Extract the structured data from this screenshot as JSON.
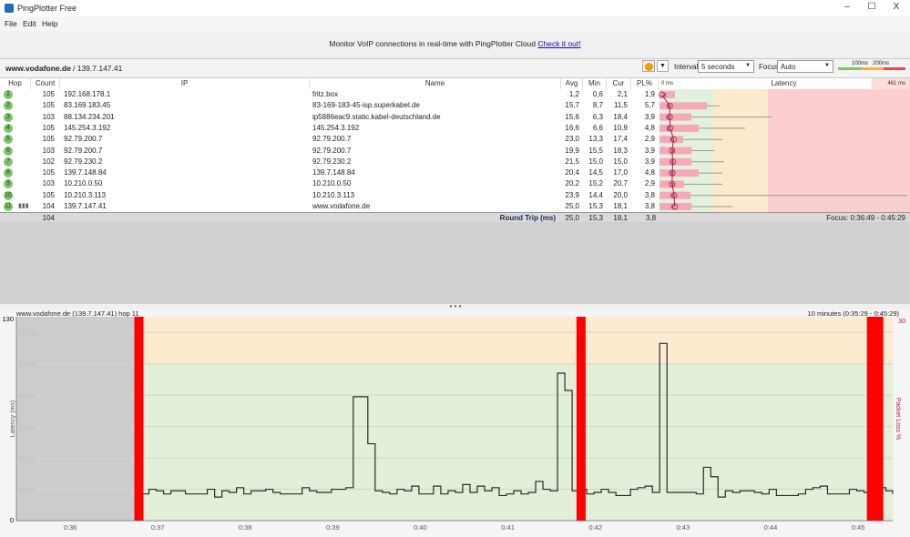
{
  "window": {
    "title": "PingPlotter Free",
    "minimize": "–",
    "maximize": "☐",
    "close": "X"
  },
  "menu": [
    "File",
    "Edit",
    "Help"
  ],
  "banner": {
    "text": "Monitor VoIP connections in real-time with PingPlotter Cloud ",
    "link": "Check it out!"
  },
  "target": {
    "host": "www.vodafone.de",
    "ip": " / 139.7.147.41"
  },
  "toolbar": {
    "interval_label": "Interval",
    "interval_value": "5 seconds",
    "focus_label": "Focus",
    "focus_value": "Auto",
    "scale_100": "100ms",
    "scale_200": "200ms",
    "pause_icon": "pause-icon"
  },
  "columns": {
    "hop": "Hop",
    "count": "Count",
    "ip": "IP",
    "name": "Name",
    "avg": "Avg",
    "min": "Min",
    "cur": "Cur",
    "pl": "PL%",
    "latency": "Latency",
    "lat_min": "0 ms",
    "lat_max": "461 ms"
  },
  "hops": [
    {
      "hop": "1",
      "count": "105",
      "ip": "192.168.178.1",
      "name": "fritz.box",
      "avg": "1,2",
      "min": "0,6",
      "cur": "2,1",
      "pl": "1,9"
    },
    {
      "hop": "2",
      "count": "105",
      "ip": "83.169.183.45",
      "name": "83-169-183-45-isp.superkabel.de",
      "avg": "15,7",
      "min": "8,7",
      "cur": "11,5",
      "pl": "5,7"
    },
    {
      "hop": "3",
      "count": "103",
      "ip": "88.134.234.201",
      "name": "ip5886eac9.static.kabel-deutschland.de",
      "avg": "15,6",
      "min": "6,3",
      "cur": "18,4",
      "pl": "3,9"
    },
    {
      "hop": "4",
      "count": "105",
      "ip": "145.254.3.192",
      "name": "145.254.3.192",
      "avg": "16,6",
      "min": "6,6",
      "cur": "10,9",
      "pl": "4,8"
    },
    {
      "hop": "5",
      "count": "105",
      "ip": "92.79.200.7",
      "name": "92.79.200.7",
      "avg": "23,0",
      "min": "13,3",
      "cur": "17,4",
      "pl": "2,9"
    },
    {
      "hop": "6",
      "count": "103",
      "ip": "92.79.200.7",
      "name": "92.79.200.7",
      "avg": "19,9",
      "min": "15,5",
      "cur": "18,3",
      "pl": "3,9"
    },
    {
      "hop": "7",
      "count": "102",
      "ip": "92.79.230.2",
      "name": "92.79.230.2",
      "avg": "21,5",
      "min": "15,0",
      "cur": "15,0",
      "pl": "3,9"
    },
    {
      "hop": "8",
      "count": "105",
      "ip": "139.7.148.84",
      "name": "139.7.148.84",
      "avg": "20,4",
      "min": "14,5",
      "cur": "17,0",
      "pl": "4,8"
    },
    {
      "hop": "9",
      "count": "103",
      "ip": "10.210.0.50",
      "name": "10.210.0.50",
      "avg": "20,2",
      "min": "15,2",
      "cur": "20,7",
      "pl": "2,9"
    },
    {
      "hop": "10",
      "count": "105",
      "ip": "10.210.3.113",
      "name": "10.210.3.113",
      "avg": "23,9",
      "min": "14,4",
      "cur": "20,0",
      "pl": "3,8"
    },
    {
      "hop": "11",
      "count": "104",
      "ip": "139.7.147.41",
      "name": "www.vodafone.de",
      "avg": "25,0",
      "min": "15,3",
      "cur": "18,1",
      "pl": "3,8"
    }
  ],
  "totals": {
    "count": "104",
    "label": "Round Trip (ms)",
    "avg": "25,0",
    "min": "15,3",
    "cur": "18,1",
    "pl": "3,8",
    "focus": "Focus: 0:36:49 - 0:45:29"
  },
  "splitter": "• • •",
  "chart_data": {
    "type": "line",
    "title": "www.vodafone.de (139.7.147.41) hop 11",
    "range_label": "10 minutes (0:35:29 - 0:45:29)",
    "ylabel": "Latency (ms)",
    "y2label": "Packet Loss %",
    "ylim": [
      0,
      130
    ],
    "y2max": "30",
    "ymin_label": "0",
    "ymax_label": "130",
    "ytick_labels": [
      "20 ms",
      "40 ms",
      "60 ms",
      "80 ms",
      "100 ms",
      "120 ms"
    ],
    "xlim": [
      "0:35:29",
      "0:45:29"
    ],
    "xtick_labels": [
      "0:36",
      "0:37",
      "0:38",
      "0:39",
      "0:40",
      "0:41",
      "0:42",
      "0:43",
      "0:44",
      "0:45"
    ],
    "bands": [
      {
        "from": 0,
        "to": 100,
        "color": "#e2efd9"
      },
      {
        "from": 100,
        "to": 130,
        "color": "#fdebd0"
      }
    ],
    "grid": true,
    "latency": {
      "start": "0:36:49",
      "interval_s": 5,
      "values": [
        17,
        20,
        19,
        17,
        19,
        19,
        17,
        17,
        17,
        20,
        15,
        19,
        18,
        21,
        17,
        19,
        19,
        20,
        18,
        17,
        17,
        17,
        21,
        19,
        18,
        18,
        20,
        20,
        21,
        79,
        79,
        49,
        19,
        18,
        17,
        20,
        19,
        22,
        17,
        17,
        22,
        17,
        19,
        18,
        23,
        18,
        22,
        19,
        21,
        16,
        17,
        19,
        17,
        18,
        25,
        20,
        19,
        94,
        83,
        19,
        20,
        17,
        18,
        20,
        18,
        16,
        16,
        20,
        21,
        22,
        18,
        113,
        18,
        18,
        18,
        18,
        17,
        34,
        28,
        15,
        19,
        18,
        19,
        19,
        18,
        17,
        20,
        16,
        16,
        16,
        17,
        20,
        21,
        22,
        17,
        17,
        17,
        20,
        19,
        18,
        21,
        21,
        19,
        17
      ]
    },
    "packet_loss": [
      {
        "time": "0:36:44",
        "duration_s": 5
      },
      {
        "time": "0:41:47",
        "duration_s": 5
      },
      {
        "time": "0:45:06",
        "duration_s": 10
      }
    ],
    "colors": {
      "line": "#2b2b2b",
      "loss": "#ff0000",
      "no_data": "#cccccc"
    }
  }
}
